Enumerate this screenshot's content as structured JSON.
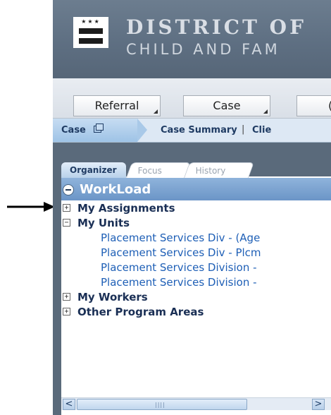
{
  "header": {
    "title_line1": "DISTRICT OF",
    "title_line2": "CHILD AND FAM",
    "logo_stars": "★★★"
  },
  "menubar": {
    "buttons": [
      "Referral",
      "Case",
      "("
    ]
  },
  "breadcrumb": {
    "active": "Case",
    "items": [
      "Case Summary",
      "Clie"
    ],
    "separator": "|"
  },
  "organizer": {
    "tabs": [
      "Organizer",
      "Focus",
      "History"
    ],
    "workload_title": "WorkLoad",
    "tree": [
      {
        "label": "My Assignments",
        "expanded": false,
        "toggle": "+"
      },
      {
        "label": "My Units",
        "expanded": true,
        "toggle": "−",
        "children": [
          "Placement Services Div - (Age",
          "Placement Services Div - Plcm",
          "Placement Services Division -",
          "Placement Services Division -"
        ]
      },
      {
        "label": "My Workers",
        "expanded": false,
        "toggle": "+"
      },
      {
        "label": "Other Program Areas",
        "expanded": false,
        "toggle": "+"
      }
    ]
  },
  "scrollbar": {
    "left_arrow": "<",
    "right_arrow": ">",
    "grip": "||||"
  },
  "colors": {
    "header_bg": "#5e6f82",
    "workload_header": "#7da4d1",
    "unit_link": "#1e5fb6"
  }
}
